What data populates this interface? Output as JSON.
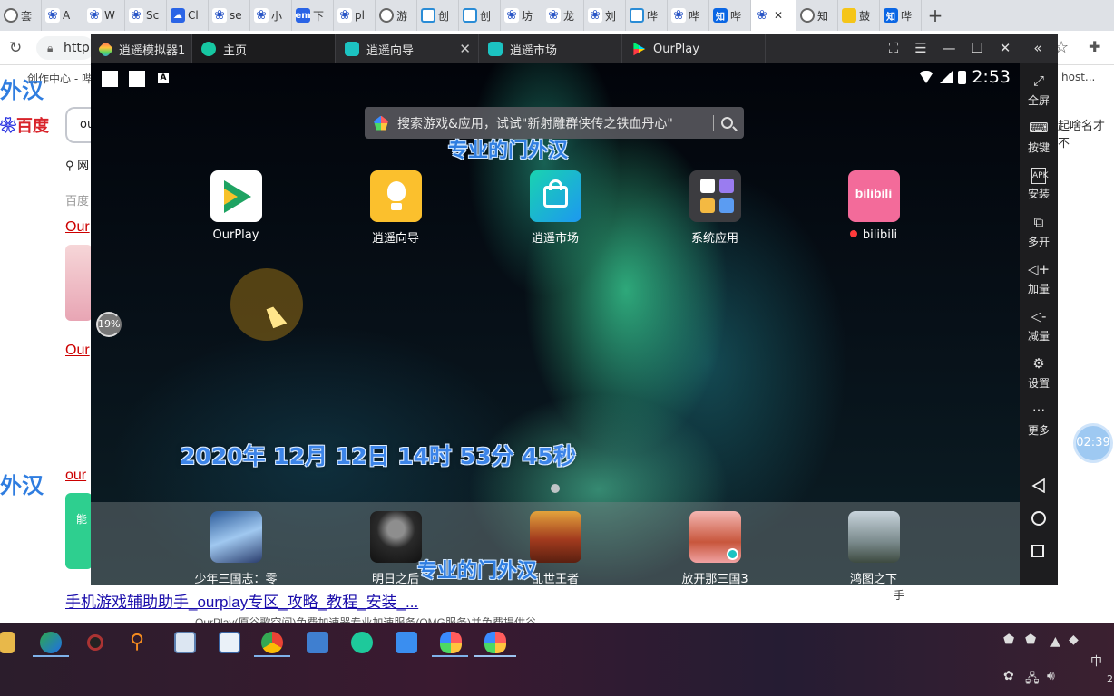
{
  "browser": {
    "tabs": [
      {
        "icon": "globe-icon",
        "label": "套"
      },
      {
        "icon": "paw-icon",
        "label": "A"
      },
      {
        "icon": "paw-icon",
        "label": "W"
      },
      {
        "icon": "paw-icon",
        "label": "Sc"
      },
      {
        "icon": "cloud-icon",
        "label": "Cl"
      },
      {
        "icon": "paw-icon",
        "label": "se"
      },
      {
        "icon": "paw-icon",
        "label": "小"
      },
      {
        "icon": "em-icon",
        "label": "下"
      },
      {
        "icon": "paw-icon",
        "label": "pl"
      },
      {
        "icon": "globe-icon",
        "label": "游"
      },
      {
        "icon": "tv-icon",
        "label": "创"
      },
      {
        "icon": "tv-icon",
        "label": "创"
      },
      {
        "icon": "paw-icon",
        "label": "坊"
      },
      {
        "icon": "paw-icon",
        "label": "龙"
      },
      {
        "icon": "paw-icon",
        "label": "刘"
      },
      {
        "icon": "tv-icon",
        "label": "哔"
      },
      {
        "icon": "paw-icon",
        "label": "哔"
      },
      {
        "icon": "zhihu-icon",
        "label": "哔"
      },
      {
        "icon": "paw-icon",
        "label": "",
        "active": true
      },
      {
        "icon": "globe-icon",
        "label": "知"
      },
      {
        "icon": "note-icon",
        "label": "鼓"
      },
      {
        "icon": "zhihu-icon",
        "label": "哔"
      }
    ],
    "address_prefix": "http",
    "zhi_glyph": "知",
    "close_glyph": "✕",
    "new_tab_glyph": "+"
  },
  "web_page": {
    "bookmark_left": "创作中心 - 哔",
    "bookmark_right": "host...",
    "left_fragment_1": "外汉",
    "baidu_logo": "百度",
    "search_value": "ou",
    "nav_item": "网",
    "baidu_hint": "百度",
    "result_link_1": "Our",
    "result_link_2": "Our",
    "left_fragment_2": "外汉",
    "result_link_3": "our",
    "thumb_text": "能",
    "right_snippet": "起啥名才不",
    "bottom_link": "手机游戏辅助助手_ourplay专区_攻略_教程_安装_...",
    "bottom_snippet": "OurPlay(原谷歌空间)免费加速器专业加速服务(OMG服务)并免费提供谷",
    "small_char": "手"
  },
  "emulator": {
    "tabs": [
      {
        "label": "逍遥模拟器1"
      },
      {
        "label": "主页"
      },
      {
        "label": "逍遥向导"
      },
      {
        "label": "逍遥市场"
      },
      {
        "label": "OurPlay"
      }
    ],
    "android": {
      "clock": "2:53",
      "status_letter": "A",
      "search_placeholder": "搜索游戏&应用，试试\"新射雕群侠传之铁血丹心\"",
      "watermark_top": "专业的门外汉",
      "watermark_bottom": "专业的门外汉",
      "datetime_overlay": "2020年 12月 12日 14时 53分 45秒",
      "progress_percent": "19%",
      "apps": [
        {
          "label": "OurPlay"
        },
        {
          "label": "逍遥向导"
        },
        {
          "label": "逍遥市场"
        },
        {
          "label": "系统应用"
        },
        {
          "label": "bilibili",
          "icon_text": "bilibili"
        }
      ],
      "dock": [
        {
          "label": "少年三国志：零"
        },
        {
          "label": "明日之后"
        },
        {
          "label": "乱世王者"
        },
        {
          "label": "放开那三国3"
        },
        {
          "label": "鸿图之下"
        }
      ]
    },
    "toolbar": [
      {
        "label": "全屏",
        "icon": "fullscreen-icon"
      },
      {
        "label": "按键",
        "icon": "keyboard-icon"
      },
      {
        "label": "安装",
        "icon": "apk-icon"
      },
      {
        "label": "多开",
        "icon": "multi-instance-icon"
      },
      {
        "label": "加量",
        "icon": "volume-up-icon"
      },
      {
        "label": "减量",
        "icon": "volume-down-icon"
      },
      {
        "label": "设置",
        "icon": "gear-icon"
      },
      {
        "label": "更多",
        "icon": "more-icon"
      }
    ],
    "apk_glyph": "APK"
  },
  "floating_timer": "02:39",
  "taskbar": {
    "ime": "中",
    "clock_fragment": "2"
  }
}
